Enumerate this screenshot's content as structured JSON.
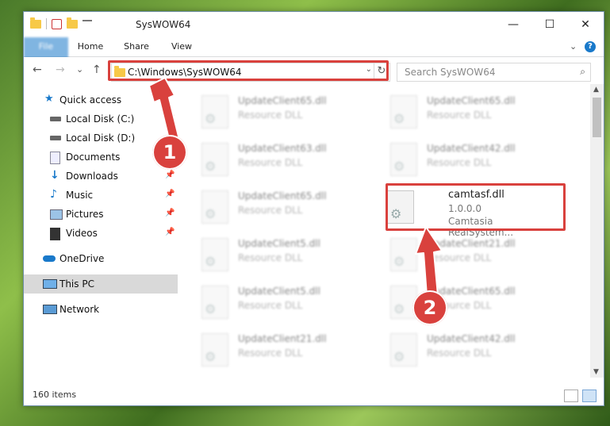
{
  "window": {
    "title": "SysWOW64",
    "controls": {
      "minimize": "—",
      "maximize": "☐",
      "close": "✕"
    }
  },
  "ribbon": {
    "tabs": [
      "File",
      "Home",
      "Share",
      "View"
    ],
    "help": "?",
    "expand": "⌄"
  },
  "navigation": {
    "back": "←",
    "forward": "→",
    "recent": "⌄",
    "up": "↑",
    "address": "C:\\Windows\\SysWOW64",
    "address_dropdown": "⌄",
    "refresh": "↻",
    "search_placeholder": "Search SysWOW64",
    "search_icon": "⌕"
  },
  "sidebar": {
    "items": [
      {
        "label": "Quick access",
        "icon": "star-icon",
        "pinned": false
      },
      {
        "label": "Local Disk (C:)",
        "icon": "drive-icon",
        "pinned": true
      },
      {
        "label": "Local Disk (D:)",
        "icon": "drive-icon",
        "pinned": false
      },
      {
        "label": "Documents",
        "icon": "documents-icon",
        "pinned": true
      },
      {
        "label": "Downloads",
        "icon": "download-icon",
        "pinned": true
      },
      {
        "label": "Music",
        "icon": "music-icon",
        "pinned": true
      },
      {
        "label": "Pictures",
        "icon": "pictures-icon",
        "pinned": true
      },
      {
        "label": "Videos",
        "icon": "videos-icon",
        "pinned": true
      },
      {
        "label": "OneDrive",
        "icon": "cloud-icon",
        "pinned": false
      },
      {
        "label": "This PC",
        "icon": "computer-icon",
        "pinned": false,
        "selected": true
      },
      {
        "label": "Network",
        "icon": "network-icon",
        "pinned": false
      }
    ],
    "pin_glyph": "📌"
  },
  "files": [
    {
      "name": "UpdateClient65.dll",
      "type": "Resource DLL"
    },
    {
      "name": "UpdateClient65.dll",
      "type": "Resource DLL"
    },
    {
      "name": "UpdateClient63.dll",
      "type": "Resource DLL"
    },
    {
      "name": "UpdateClient42.dll",
      "type": "Resource DLL"
    },
    {
      "name": "UpdateClient65.dll",
      "type": "Resource DLL"
    },
    {
      "name": "camtasf.dll",
      "type": "1.0.0.0",
      "desc": "Camtasia RealSystem...",
      "highlighted": true
    },
    {
      "name": "UpdateClient5.dll",
      "type": "Resource DLL"
    },
    {
      "name": "UpdateClient21.dll",
      "type": "Resource DLL"
    },
    {
      "name": "UpdateClient5.dll",
      "type": "Resource DLL"
    },
    {
      "name": "UpdateClient65.dll",
      "type": "Resource DLL"
    },
    {
      "name": "UpdateClient21.dll",
      "type": "Resource DLL"
    },
    {
      "name": "UpdateClient42.dll",
      "type": "Resource DLL"
    }
  ],
  "status": {
    "items": "160 items"
  },
  "callouts": [
    "1",
    "2"
  ],
  "colors": {
    "accent": "#1979ca",
    "highlight": "#d9413d"
  }
}
